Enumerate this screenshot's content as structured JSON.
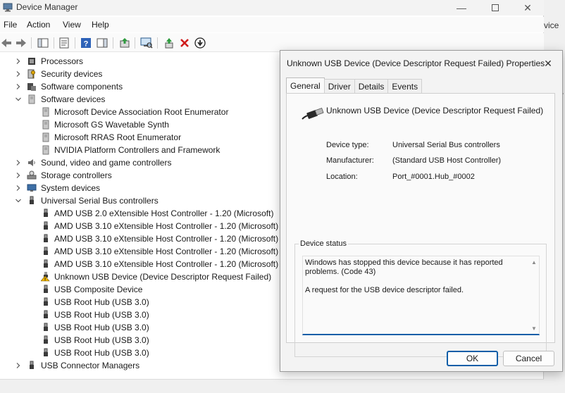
{
  "window": {
    "title": "Device Manager"
  },
  "menu": [
    "File",
    "Action",
    "View",
    "Help"
  ],
  "toolbar_icons": [
    "back-arrow-icon",
    "forward-arrow-icon",
    "show-hide-console-tree-icon",
    "properties-icon",
    "help-icon",
    "action-pane-icon",
    "update-driver-icon",
    "scan-hardware-icon",
    "enable-device-icon",
    "uninstall-device-icon",
    "download-driver-icon"
  ],
  "background_fragments": [
    "vice",
    "r"
  ],
  "tree": [
    {
      "label": "Processors",
      "level": 0,
      "expanded": false,
      "icon": "processor-icon"
    },
    {
      "label": "Security devices",
      "level": 0,
      "expanded": false,
      "icon": "key-icon"
    },
    {
      "label": "Software components",
      "level": 0,
      "expanded": false,
      "icon": "component-icon"
    },
    {
      "label": "Software devices",
      "level": 0,
      "expanded": true,
      "icon": "device-icon"
    },
    {
      "label": "Microsoft Device Association Root Enumerator",
      "level": 1,
      "icon": "device-icon"
    },
    {
      "label": "Microsoft GS Wavetable Synth",
      "level": 1,
      "icon": "device-icon"
    },
    {
      "label": "Microsoft RRAS Root Enumerator",
      "level": 1,
      "icon": "device-icon"
    },
    {
      "label": "NVIDIA Platform Controllers and Framework",
      "level": 1,
      "icon": "device-icon"
    },
    {
      "label": "Sound, video and game controllers",
      "level": 0,
      "expanded": false,
      "icon": "speaker-icon"
    },
    {
      "label": "Storage controllers",
      "level": 0,
      "expanded": false,
      "icon": "storage-icon"
    },
    {
      "label": "System devices",
      "level": 0,
      "expanded": false,
      "icon": "monitor-icon"
    },
    {
      "label": "Universal Serial Bus controllers",
      "level": 0,
      "expanded": true,
      "icon": "usb-icon"
    },
    {
      "label": "AMD USB 2.0 eXtensible Host Controller - 1.20 (Microsoft)",
      "level": 1,
      "icon": "usb-icon"
    },
    {
      "label": "AMD USB 3.10 eXtensible Host Controller - 1.20 (Microsoft)",
      "level": 1,
      "icon": "usb-icon"
    },
    {
      "label": "AMD USB 3.10 eXtensible Host Controller - 1.20 (Microsoft)",
      "level": 1,
      "icon": "usb-icon"
    },
    {
      "label": "AMD USB 3.10 eXtensible Host Controller - 1.20 (Microsoft)",
      "level": 1,
      "icon": "usb-icon"
    },
    {
      "label": "AMD USB 3.10 eXtensible Host Controller - 1.20 (Microsoft)",
      "level": 1,
      "icon": "usb-icon"
    },
    {
      "label": "Unknown USB Device (Device Descriptor Request Failed)",
      "level": 1,
      "icon": "warning-icon"
    },
    {
      "label": "USB Composite Device",
      "level": 1,
      "icon": "usb-icon"
    },
    {
      "label": "USB Root Hub (USB 3.0)",
      "level": 1,
      "icon": "usb-icon"
    },
    {
      "label": "USB Root Hub (USB 3.0)",
      "level": 1,
      "icon": "usb-icon"
    },
    {
      "label": "USB Root Hub (USB 3.0)",
      "level": 1,
      "icon": "usb-icon"
    },
    {
      "label": "USB Root Hub (USB 3.0)",
      "level": 1,
      "icon": "usb-icon"
    },
    {
      "label": "USB Root Hub (USB 3.0)",
      "level": 1,
      "icon": "usb-icon"
    },
    {
      "label": "USB Connector Managers",
      "level": 0,
      "expanded": false,
      "icon": "usb-icon"
    }
  ],
  "dialog": {
    "title": "Unknown USB Device (Device Descriptor Request Failed) Properties",
    "tabs": [
      "General",
      "Driver",
      "Details",
      "Events"
    ],
    "active_tab": "General",
    "device_name": "Unknown USB Device (Device Descriptor Request Failed)",
    "props": {
      "device_type_label": "Device type:",
      "device_type_value": "Universal Serial Bus controllers",
      "manufacturer_label": "Manufacturer:",
      "manufacturer_value": "(Standard USB Host Controller)",
      "location_label": "Location:",
      "location_value": "Port_#0001.Hub_#0002"
    },
    "status_group_label": "Device status",
    "status_text": "Windows has stopped this device because it has reported problems. (Code 43)\n\nA request for the USB device descriptor failed.",
    "ok_label": "OK",
    "cancel_label": "Cancel"
  },
  "colors": {
    "accent": "#0f5ea8",
    "warning": "#f2b705",
    "error": "#d01c1c"
  }
}
